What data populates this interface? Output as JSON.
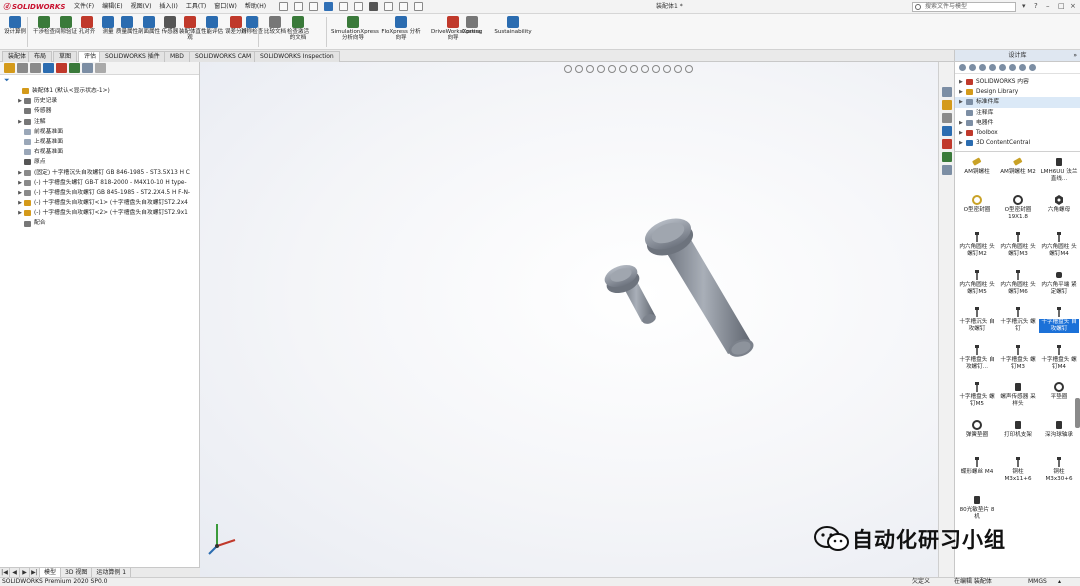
{
  "app": {
    "logo_text": "SOLIDWORKS",
    "doc_title": "装配体1 *",
    "search_placeholder": "搜索文件与模型",
    "menu": [
      "文件(F)",
      "编辑(E)",
      "视图(V)",
      "插入(I)",
      "工具(T)",
      "窗口(W)",
      "帮助(H)"
    ]
  },
  "commands": [
    {
      "label": "设计算例",
      "color": "#2b6cb0"
    },
    {
      "label": "干涉检查",
      "color": "#3a7a3a"
    },
    {
      "label": "间隙验证",
      "color": "#3a7a3a"
    },
    {
      "label": "孔对齐",
      "color": "#c0392b"
    },
    {
      "label": "测量",
      "color": "#2b6cb0"
    },
    {
      "label": "质量属性",
      "color": "#2b6cb0"
    },
    {
      "label": "剖面属性",
      "color": "#2b6cb0"
    },
    {
      "label": "传感器",
      "color": "#555555"
    },
    {
      "label": "装配体直观",
      "color": "#c0392b"
    },
    {
      "label": "性能评估",
      "color": "#2b6cb0"
    },
    {
      "label": "误差分析",
      "color": "#c0392b"
    },
    {
      "label": "对称检查",
      "color": "#2b6cb0"
    },
    {
      "label": "比较文档",
      "color": "#777777"
    },
    {
      "label": "检查激活的文档",
      "color": "#3a7a3a"
    },
    {
      "label": "SimulationXpress 分析向导",
      "color": "#3a7a3a"
    },
    {
      "label": "FloXpress 分析向导",
      "color": "#2b6cb0"
    },
    {
      "label": "DriveWorksXpress 向导",
      "color": "#c0392b"
    },
    {
      "label": "Costing",
      "color": "#777777"
    },
    {
      "label": "Sustainability",
      "color": "#2b6cb0"
    }
  ],
  "tabs": [
    "装配体",
    "布局",
    "草图",
    "评估",
    "SOLIDWORKS 插件",
    "MBD",
    "SOLIDWORKS CAM",
    "SOLIDWORKS Inspection"
  ],
  "active_tab": "评估",
  "feature_tree": [
    {
      "label": "装配体1 (默认<显示状态-1>)",
      "level": 0,
      "exp": "",
      "color": "#d49a1a"
    },
    {
      "label": "历史记录",
      "level": 1,
      "exp": "▶",
      "color": "#777777"
    },
    {
      "label": "传感器",
      "level": 1,
      "exp": "",
      "color": "#777777"
    },
    {
      "label": "注解",
      "level": 1,
      "exp": "▶",
      "color": "#777777"
    },
    {
      "label": "前视基准面",
      "level": 1,
      "exp": "",
      "color": "#9aa7b8"
    },
    {
      "label": "上视基准面",
      "level": 1,
      "exp": "",
      "color": "#9aa7b8"
    },
    {
      "label": "右视基准面",
      "level": 1,
      "exp": "",
      "color": "#9aa7b8"
    },
    {
      "label": "原点",
      "level": 1,
      "exp": "",
      "color": "#555555"
    },
    {
      "label": "(固定) 十字槽沉头自攻螺钉 GB 846-1985 - ST3.5X13 H C",
      "level": 1,
      "exp": "▶",
      "color": "#8a8a8a"
    },
    {
      "label": "(-) 十字槽盘头螺钉 GB-T 818-2000 - M4X10-10  H type-",
      "level": 1,
      "exp": "▶",
      "color": "#8a8a8a"
    },
    {
      "label": "(-) 十字槽盘头自攻螺钉 GB 845-1985 - ST2.2X4.5 H F-N-",
      "level": 1,
      "exp": "▶",
      "color": "#8a8a8a"
    },
    {
      "label": "(-) 十字槽盘头自攻螺钉<1> (十字槽盘头自攻螺钉ST2.2x4",
      "level": 1,
      "exp": "▶",
      "color": "#d49a1a"
    },
    {
      "label": "(-) 十字槽盘头自攻螺钉<2> (十字槽盘头自攻螺钉ST2.9x1",
      "level": 1,
      "exp": "▶",
      "color": "#d49a1a"
    },
    {
      "label": "配合",
      "level": 1,
      "exp": "",
      "color": "#777777"
    }
  ],
  "bottom_tabs": [
    "模型",
    "3D 视图",
    "运动算例 1"
  ],
  "status": {
    "left": "SOLIDWORKS Premium 2020 SP0.0",
    "state": "欠定义",
    "editing": "在编辑 装配体",
    "units": "MMGS"
  },
  "design_library": {
    "title": "设计库",
    "tree": [
      {
        "label": "SOLIDWORKS 内容",
        "exp": "▶",
        "color": "#c0392b"
      },
      {
        "label": "Design Library",
        "exp": "▶",
        "color": "#d49a1a"
      },
      {
        "label": "标准件库",
        "exp": "▶",
        "color": "#7c8ea4"
      },
      {
        "label": "注释库",
        "exp": "",
        "color": "#7c8ea4"
      },
      {
        "label": "电器件",
        "exp": "▶",
        "color": "#7c8ea4"
      },
      {
        "label": "Toolbox",
        "exp": "▶",
        "color": "#c0392b"
      },
      {
        "label": "3D ContentCentral",
        "exp": "▶",
        "color": "#2b6cb0"
      }
    ],
    "selected_index": 2,
    "parts": [
      {
        "label": "AM铜螺柱",
        "icon": "gold"
      },
      {
        "label": "AM铜螺柱 M2",
        "icon": "gold"
      },
      {
        "label": "LMH6UU 法兰直线...",
        "icon": "dark"
      },
      {
        "label": "O型密封圈",
        "icon": "ring-gold"
      },
      {
        "label": "O型密封圈 19X1.8",
        "icon": "ring-dark"
      },
      {
        "label": "六角螺母",
        "icon": "nut"
      },
      {
        "label": "内六角圆柱 头螺钉M2",
        "icon": "screw"
      },
      {
        "label": "内六角圆柱 头螺钉M3",
        "icon": "screw"
      },
      {
        "label": "内六角圆柱 头螺钉M4",
        "icon": "screw"
      },
      {
        "label": "内六角圆柱 头螺钉M5",
        "icon": "screw"
      },
      {
        "label": "内六角圆柱 头螺钉M6",
        "icon": "screw"
      },
      {
        "label": "内六角平端 紧定螺钉",
        "icon": "set"
      },
      {
        "label": "十字槽沉头 自攻螺钉",
        "icon": "screw"
      },
      {
        "label": "十字槽沉头 螺钉",
        "icon": "screw"
      },
      {
        "label": "十字槽盘头 自攻螺钉",
        "icon": "screw"
      },
      {
        "label": "十字槽盘头 自攻螺钉...",
        "icon": "screw"
      },
      {
        "label": "十字槽盘头 螺钉M3",
        "icon": "screw"
      },
      {
        "label": "十字槽盘头 螺钉M4",
        "icon": "screw"
      },
      {
        "label": "十字槽盘头 螺钉M5",
        "icon": "screw"
      },
      {
        "label": "螺声传感器 采样头",
        "icon": "dark"
      },
      {
        "label": "平垫圈",
        "icon": "ring-dark"
      },
      {
        "label": "弹簧垫圈",
        "icon": "ring-dark"
      },
      {
        "label": "打印机支架",
        "icon": "dark"
      },
      {
        "label": "深沟球轴承",
        "icon": "dark"
      },
      {
        "label": "蝶形螺丝 M4",
        "icon": "screw"
      },
      {
        "label": "铜柱 M3x11+6",
        "icon": "screw"
      },
      {
        "label": "铜柱 M3x30+6",
        "icon": "screw"
      },
      {
        "label": "80光敏垫片 8机",
        "icon": "dark"
      }
    ],
    "selected_part": 14
  },
  "watermark": "自动化研习小组",
  "colors": {
    "accent": "#1c71d8",
    "logo_red": "#c8102e",
    "part_gray": "#8c929c"
  }
}
